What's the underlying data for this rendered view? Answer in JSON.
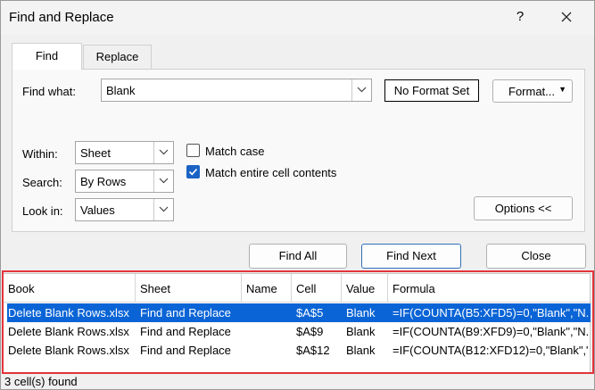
{
  "title": "Find and Replace",
  "title_buttons": {
    "help": "?",
    "close_icon": "close-icon"
  },
  "tabs": [
    {
      "label": "Find",
      "active": true
    },
    {
      "label": "Replace",
      "active": false
    }
  ],
  "find": {
    "label": "Find what:",
    "value": "Blank",
    "no_format": "No Format Set",
    "format_button": "Format..."
  },
  "options": {
    "within": {
      "label": "Within:",
      "value": "Sheet"
    },
    "search": {
      "label": "Search:",
      "value": "By Rows"
    },
    "look_in": {
      "label": "Look in:",
      "value": "Values"
    },
    "match_case": {
      "label": "Match case",
      "checked": false
    },
    "match_entire": {
      "label": "Match entire cell contents",
      "checked": true
    },
    "options_button": "Options <<"
  },
  "buttons": {
    "find_all": "Find All",
    "find_next": "Find Next",
    "close": "Close"
  },
  "results": {
    "columns": [
      "Book",
      "Sheet",
      "Name",
      "Cell",
      "Value",
      "Formula"
    ],
    "rows": [
      {
        "book": "Delete Blank Rows.xlsx",
        "sheet": "Find and Replace",
        "name": "",
        "cell": "$A$5",
        "value": "Blank",
        "formula": "=IF(COUNTA(B5:XFD5)=0,\"Blank\",\"N...",
        "selected": true
      },
      {
        "book": "Delete Blank Rows.xlsx",
        "sheet": "Find and Replace",
        "name": "",
        "cell": "$A$9",
        "value": "Blank",
        "formula": "=IF(COUNTA(B9:XFD9)=0,\"Blank\",\"N...",
        "selected": false
      },
      {
        "book": "Delete Blank Rows.xlsx",
        "sheet": "Find and Replace",
        "name": "",
        "cell": "$A$12",
        "value": "Blank",
        "formula": "=IF(COUNTA(B12:XFD12)=0,\"Blank\",\"...",
        "selected": false
      }
    ],
    "status": "3 cell(s) found"
  },
  "colors": {
    "selection": "#0a64d6",
    "highlight_frame": "#e2343b",
    "check_accent": "#1a63c4"
  }
}
